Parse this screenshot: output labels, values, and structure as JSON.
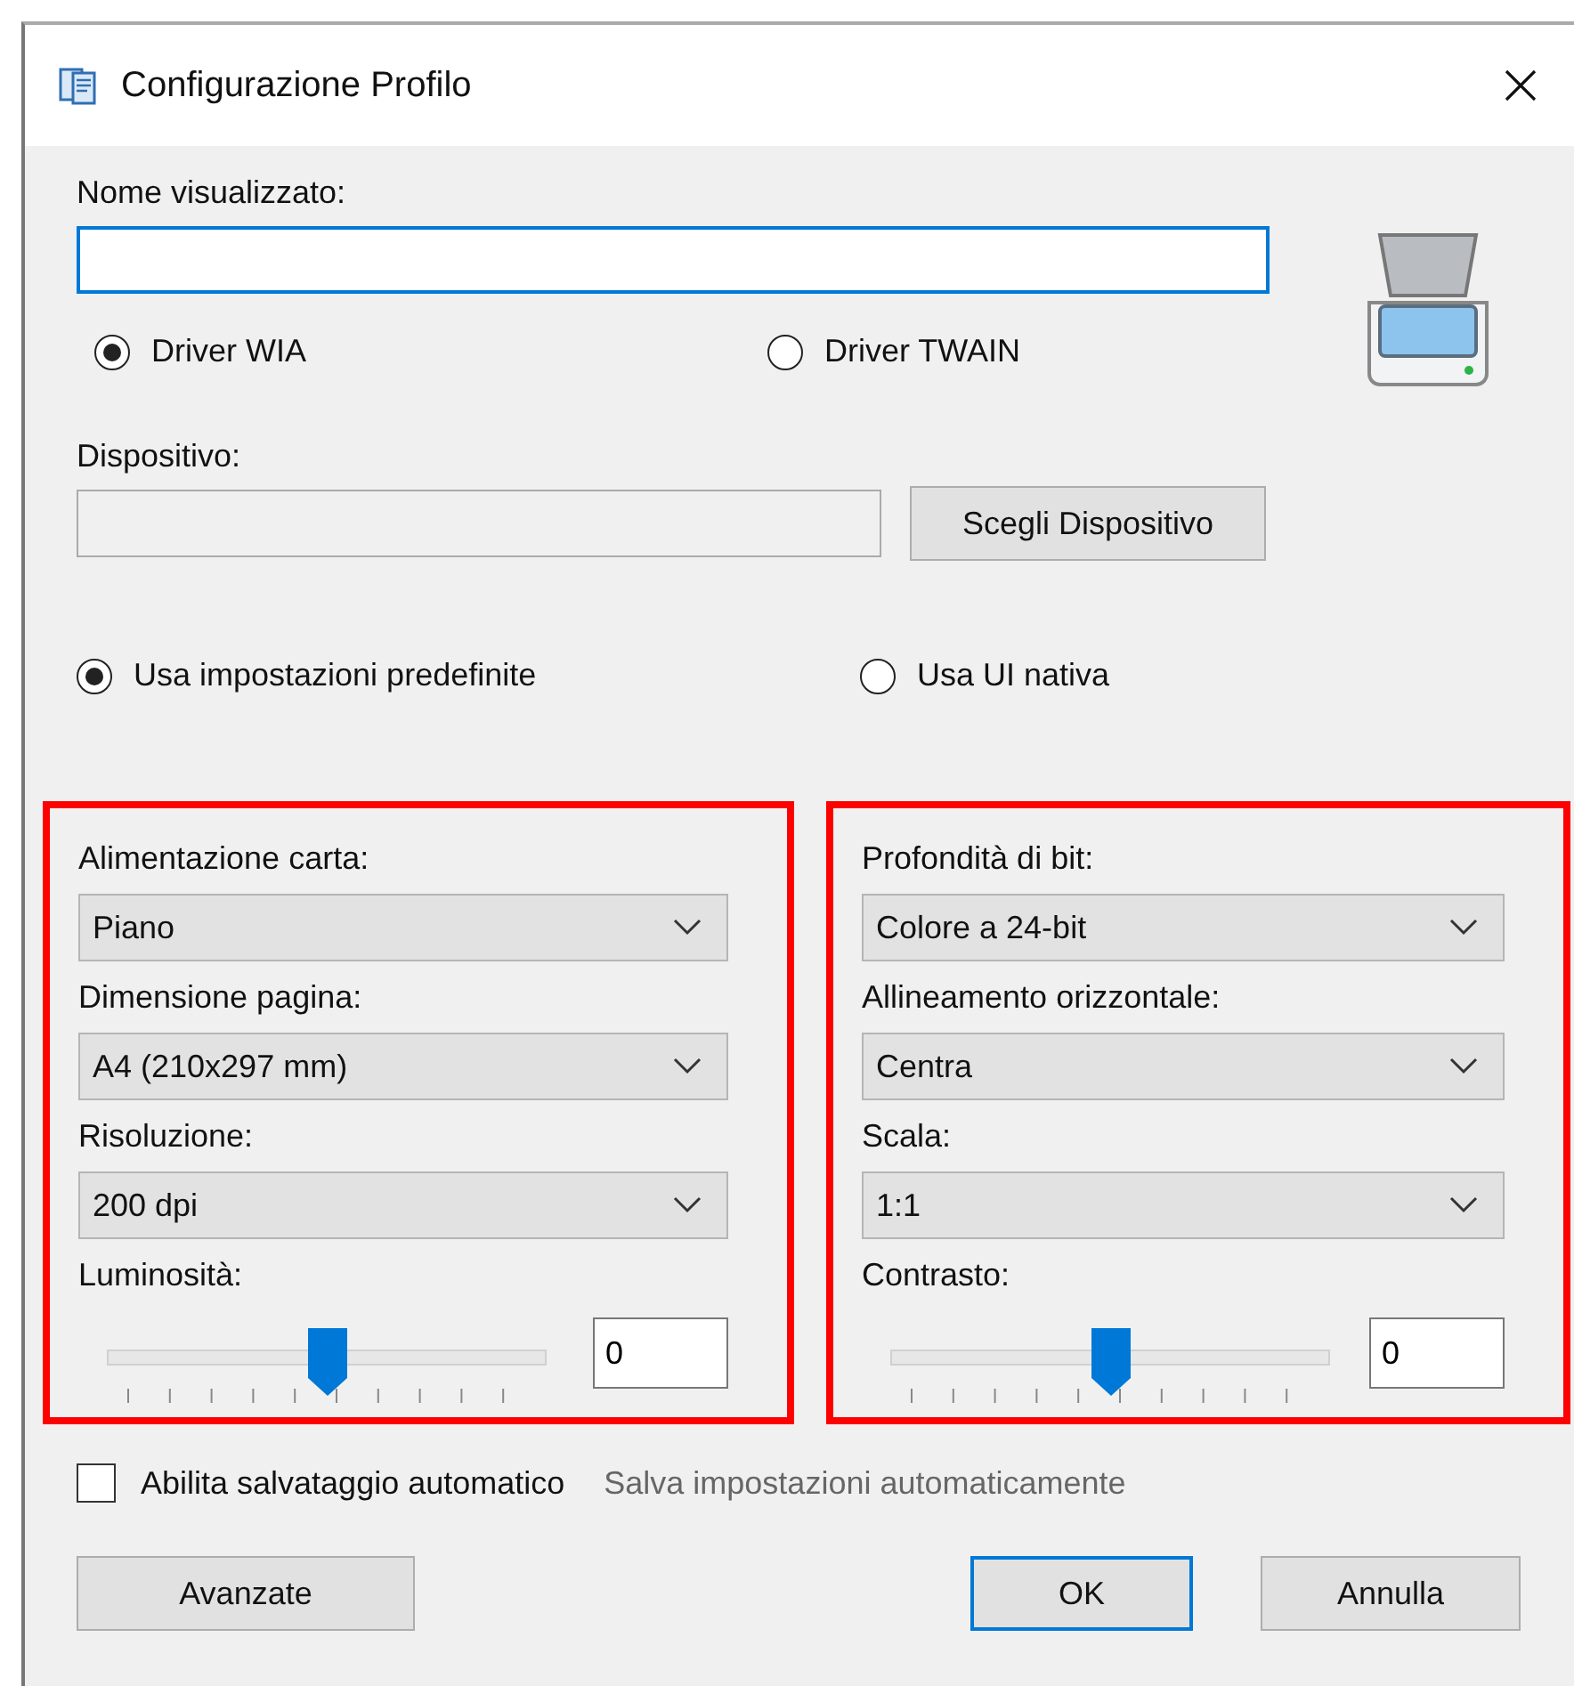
{
  "window": {
    "title": "Configurazione Profilo"
  },
  "display_name": {
    "label": "Nome visualizzato:"
  },
  "driver_options": [
    {
      "label": "Driver WIA",
      "selected": true
    },
    {
      "label": "Driver TWAIN",
      "selected": false
    }
  ],
  "device": {
    "label": "Dispositivo:",
    "button": "Scegli Dispositivo"
  },
  "settings_mode": [
    {
      "label": "Usa impostazioni predefinite",
      "selected": true
    },
    {
      "label": "Usa UI nativa",
      "selected": false
    }
  ],
  "panels": [
    {
      "highlighted": true,
      "fields": [
        {
          "kind": "dropdown",
          "label": "Alimentazione carta:",
          "value": "Piano"
        },
        {
          "kind": "dropdown",
          "label": "Dimensione pagina:",
          "value": "A4 (210x297 mm)"
        },
        {
          "kind": "dropdown",
          "label": "Risoluzione:",
          "value": "200 dpi"
        },
        {
          "kind": "slider",
          "label": "Luminosità:",
          "level": 0.5,
          "value": "0"
        }
      ]
    },
    {
      "highlighted": true,
      "fields": [
        {
          "kind": "dropdown",
          "label": "Profondità di bit:",
          "value": "Colore a 24-bit"
        },
        {
          "kind": "dropdown",
          "label": "Allineamento orizzontale:",
          "value": "Centra"
        },
        {
          "kind": "dropdown",
          "label": "Scala:",
          "value": "1:1"
        },
        {
          "kind": "slider",
          "label": "Contrasto:",
          "level": 0.5,
          "value": "0"
        }
      ]
    }
  ],
  "auto_save": {
    "label": "Abilita salvataggio automatico",
    "checked": false,
    "hint": "Salva impostazioni automaticamente"
  },
  "buttons": [
    {
      "label": "Avanzate",
      "kind": "default"
    },
    {
      "label": "OK",
      "kind": "primary"
    },
    {
      "label": "Annulla",
      "kind": "default"
    }
  ]
}
